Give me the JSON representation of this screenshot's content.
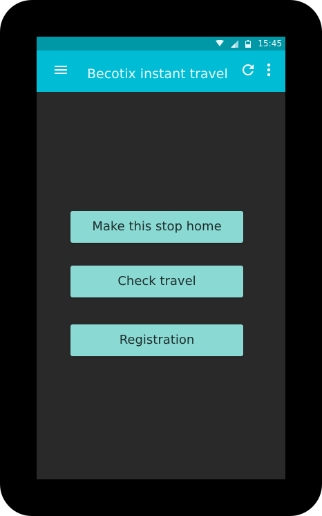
{
  "colors": {
    "frame": "#000000",
    "status_bar": "#0097a7",
    "app_bar": "#00bcd4",
    "background": "#292929",
    "button": "#8ad9d3",
    "button_text": "#1c2b2a"
  },
  "status_bar": {
    "time": "15:45",
    "icons": [
      "wifi-icon",
      "cell-signal-icon",
      "battery-icon"
    ]
  },
  "app_bar": {
    "title": "Becotix instant travel",
    "icons": [
      "menu-icon",
      "refresh-icon",
      "more-vert-icon"
    ]
  },
  "main": {
    "buttons": [
      {
        "label": "Make this stop home"
      },
      {
        "label": "Check travel"
      },
      {
        "label": "Registration"
      }
    ]
  }
}
